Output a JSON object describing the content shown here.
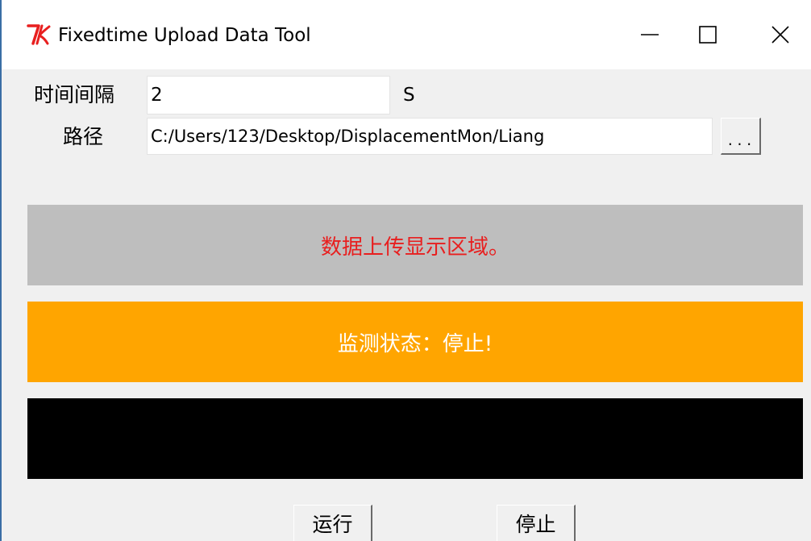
{
  "window": {
    "title": "Fixedtime Upload Data Tool",
    "icon": "tk-feather-icon",
    "controls": {
      "minimize_icon": "minimize-icon",
      "maximize_icon": "maximize-icon",
      "close_icon": "close-icon"
    }
  },
  "form": {
    "interval_label": "时间间隔",
    "interval_value": "2",
    "interval_unit": "S",
    "path_label": "路径",
    "path_value": "C:/Users/123/Desktop/DisplacementMon/Liang",
    "browse_label": "..."
  },
  "panels": {
    "upload_text": "数据上传显示区域。",
    "status_text": "监测状态：停止!",
    "log_text": ""
  },
  "actions": {
    "run_label": "运行",
    "stop_label": "停止"
  },
  "colors": {
    "upload_bg": "#bebebe",
    "upload_text": "#e81f1f",
    "status_bg": "#ffa500",
    "status_text": "#ffffff",
    "log_bg": "#000000",
    "icon_red": "#e81f1f"
  }
}
